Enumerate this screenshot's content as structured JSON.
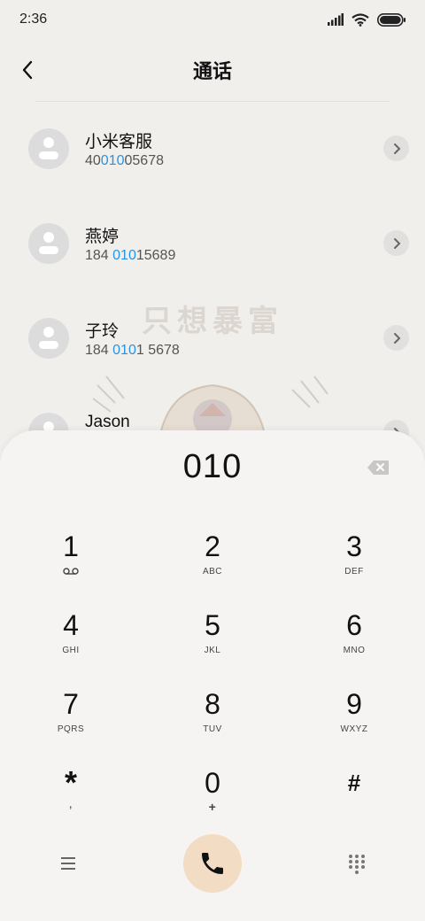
{
  "status": {
    "time": "2:36"
  },
  "header": {
    "title": "通话"
  },
  "contacts": [
    {
      "name": "小米客服",
      "num_pre": "40",
      "num_hl": "010",
      "num_post": "05678"
    },
    {
      "name": "燕婷",
      "num_pre": "184 ",
      "num_hl": "010",
      "num_post": "15689"
    },
    {
      "name": "子玲",
      "num_pre": "184 ",
      "num_hl": "010",
      "num_post": "1 5678"
    },
    {
      "name": "Jason",
      "num_pre": "",
      "num_hl": "",
      "num_post": ""
    }
  ],
  "watermark": {
    "text": "只想暴富"
  },
  "dialpad": {
    "input": "010",
    "keys": [
      {
        "digit": "1",
        "letters": ""
      },
      {
        "digit": "2",
        "letters": "ABC"
      },
      {
        "digit": "3",
        "letters": "DEF"
      },
      {
        "digit": "4",
        "letters": "GHI"
      },
      {
        "digit": "5",
        "letters": "JKL"
      },
      {
        "digit": "6",
        "letters": "MNO"
      },
      {
        "digit": "7",
        "letters": "PQRS"
      },
      {
        "digit": "8",
        "letters": "TUV"
      },
      {
        "digit": "9",
        "letters": "WXYZ"
      },
      {
        "digit": "*",
        "letters": ","
      },
      {
        "digit": "0",
        "letters": "+"
      },
      {
        "digit": "#",
        "letters": ""
      }
    ]
  },
  "icons": {
    "signal": "signal-icon",
    "wifi": "wifi-icon",
    "battery": "battery-icon",
    "back": "back-arrow-icon",
    "chevron": "chevron-right-icon",
    "backspace": "backspace-icon",
    "voicemail": "voicemail-icon",
    "menu": "menu-icon",
    "call": "phone-icon",
    "keypad": "keypad-icon"
  },
  "colors": {
    "highlight": "#2594e6",
    "call_button": "#f2dcc3",
    "background": "#f1efec"
  }
}
